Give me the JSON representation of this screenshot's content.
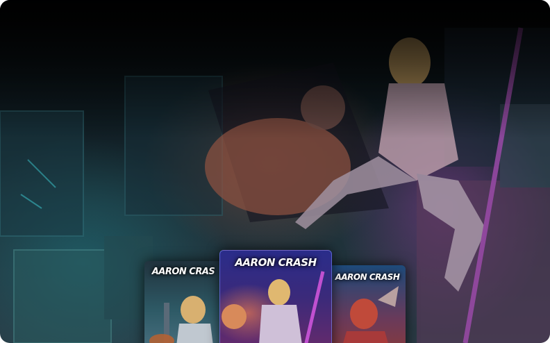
{
  "carousel": {
    "cards": [
      {
        "title": "AARON CRAS"
      },
      {
        "title": "AARON CRASH"
      },
      {
        "title": "AARON CRASH"
      }
    ]
  },
  "colors": {
    "accent_teal": "#2f7f88",
    "accent_magenta": "#a04aa8",
    "planet_orange": "#c07a52"
  }
}
